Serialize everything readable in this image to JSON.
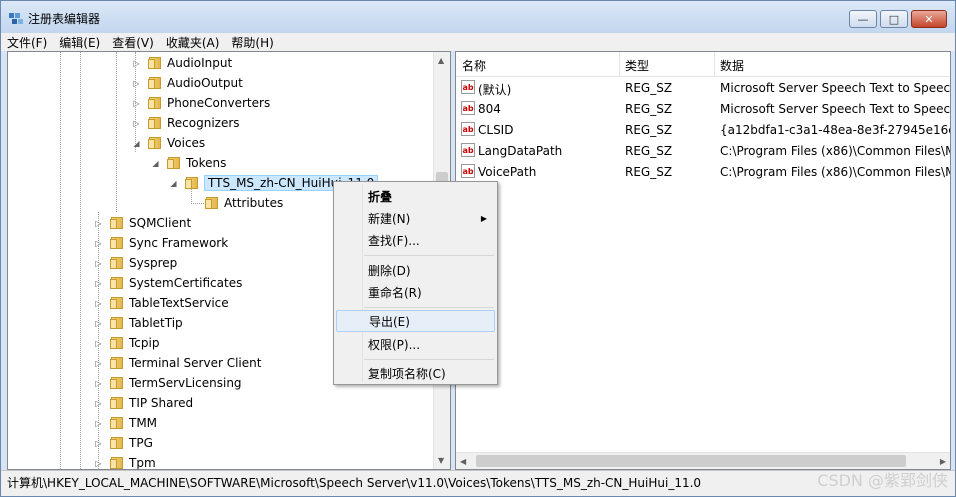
{
  "window": {
    "title": "注册表编辑器",
    "minimize_glyph": "—",
    "maximize_glyph": "□",
    "close_glyph": "✕"
  },
  "menu": [
    "文件(F)",
    "编辑(E)",
    "查看(V)",
    "收藏夹(A)",
    "帮助(H)"
  ],
  "tree": {
    "items": [
      {
        "label": "AudioInput",
        "expander": "▷"
      },
      {
        "label": "AudioOutput",
        "expander": "▷"
      },
      {
        "label": "PhoneConverters",
        "expander": "▷"
      },
      {
        "label": "Recognizers",
        "expander": "▷"
      },
      {
        "label": "Voices",
        "expander": "◢"
      },
      {
        "label": "Tokens",
        "expander": "◢"
      },
      {
        "label": "TTS_MS_zh-CN_HuiHui_11.0",
        "expander": "◢",
        "selected": true
      },
      {
        "label": "Attributes",
        "expander": ""
      },
      {
        "label": "SQMClient",
        "expander": "▷"
      },
      {
        "label": "Sync Framework",
        "expander": "▷"
      },
      {
        "label": "Sysprep",
        "expander": "▷"
      },
      {
        "label": "SystemCertificates",
        "expander": "▷"
      },
      {
        "label": "TableTextService",
        "expander": "▷"
      },
      {
        "label": "TabletTip",
        "expander": "▷"
      },
      {
        "label": "Tcpip",
        "expander": "▷"
      },
      {
        "label": "Terminal Server Client",
        "expander": "▷"
      },
      {
        "label": "TermServLicensing",
        "expander": "▷"
      },
      {
        "label": "TIP Shared",
        "expander": "▷"
      },
      {
        "label": "TMM",
        "expander": "▷"
      },
      {
        "label": "TPG",
        "expander": "▷"
      },
      {
        "label": "Tpm",
        "expander": "▷"
      }
    ]
  },
  "list": {
    "columns": [
      "名称",
      "类型",
      "数据"
    ],
    "rows": [
      {
        "name": "(默认)",
        "type": "REG_SZ",
        "data": "Microsoft Server Speech Text to Speec"
      },
      {
        "name": "804",
        "type": "REG_SZ",
        "data": "Microsoft Server Speech Text to Speec"
      },
      {
        "name": "CLSID",
        "type": "REG_SZ",
        "data": "{a12bdfa1-c3a1-48ea-8e3f-27945e16cf"
      },
      {
        "name": "LangDataPath",
        "type": "REG_SZ",
        "data": "C:\\Program Files (x86)\\Common Files\\M"
      },
      {
        "name": "VoicePath",
        "type": "REG_SZ",
        "data": "C:\\Program Files (x86)\\Common Files\\M"
      }
    ],
    "value_icon": "ab"
  },
  "context_menu": {
    "items": [
      "折叠",
      "新建(N)",
      "查找(F)...",
      "删除(D)",
      "重命名(R)",
      "导出(E)",
      "权限(P)...",
      "复制项名称(C)"
    ],
    "submenu_arrow": "▶",
    "highlighted": "导出(E)"
  },
  "statusbar": {
    "path": "计算机\\HKEY_LOCAL_MACHINE\\SOFTWARE\\Microsoft\\Speech Server\\v11.0\\Voices\\Tokens\\TTS_MS_zh-CN_HuiHui_11.0"
  },
  "watermark": "CSDN @紫郢剑侠",
  "scroll_glyphs": {
    "up": "▲",
    "down": "▼",
    "left": "◀",
    "right": "▶"
  }
}
